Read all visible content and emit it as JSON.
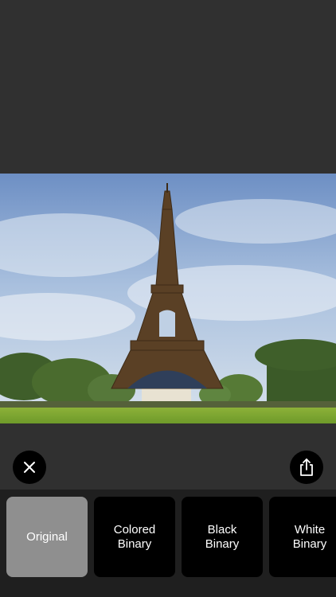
{
  "photo": {
    "subject": "eiffel-tower-landscape"
  },
  "actions": {
    "close_icon": "close-icon",
    "share_icon": "share-icon"
  },
  "filters": [
    {
      "label": "Original",
      "selected": true
    },
    {
      "label": "Colored\nBinary",
      "selected": false
    },
    {
      "label": "Black\nBinary",
      "selected": false
    },
    {
      "label": "White\nBinary",
      "selected": false
    }
  ],
  "colors": {
    "background": "#303030",
    "strip": "#1f1f1f",
    "selected_filter": "#8f8f8f",
    "filter": "#000000"
  }
}
